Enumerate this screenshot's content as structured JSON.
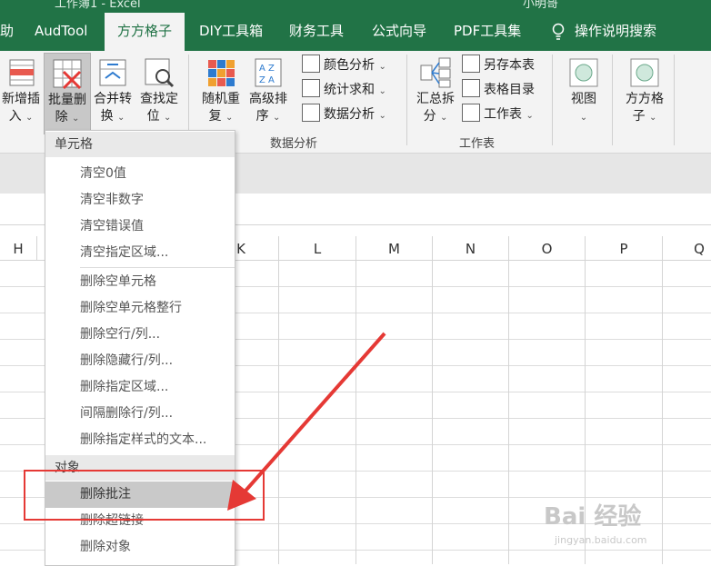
{
  "titlebar": {
    "title": "工作簿1 - Excel",
    "user": "小明哥"
  },
  "tabs": [
    {
      "label": "助"
    },
    {
      "label": "AudTool"
    },
    {
      "label": "方方格子"
    },
    {
      "label": "DIY工具箱"
    },
    {
      "label": "财务工具"
    },
    {
      "label": "公式向导"
    },
    {
      "label": "PDF工具集"
    },
    {
      "label": "操作说明搜索"
    }
  ],
  "ribbon": {
    "buttons": [
      {
        "line1": "新增插",
        "line2": "入"
      },
      {
        "line1": "批量删",
        "line2": "除"
      },
      {
        "line1": "合并转",
        "line2": "换"
      },
      {
        "line1": "查找定",
        "line2": "位"
      },
      {
        "line1": "随机重",
        "line2": "复"
      },
      {
        "line1": "高级排",
        "line2": "序"
      },
      {
        "line1": "汇总拆",
        "line2": "分"
      },
      {
        "line1": "视图",
        "line2": ""
      },
      {
        "line1": "方方格",
        "line2": "子"
      }
    ],
    "small": {
      "color_analysis": "颜色分析",
      "stat_sum": "统计求和",
      "data_analysis": "数据分析",
      "save_sheet": "另存本表",
      "sheet_index": "表格目录",
      "worksheet": "工作表"
    },
    "groups": {
      "data_analysis": "数据分析",
      "worksheet": "工作表"
    },
    "icon_letters": {
      "az_top": "A Z",
      "az_bottom": "Z A"
    }
  },
  "columns": [
    "H",
    "K",
    "L",
    "M",
    "N",
    "O",
    "P",
    "Q"
  ],
  "menu": {
    "section1": "单元格",
    "items1": [
      "清空0值",
      "清空非数字",
      "清空错误值",
      "清空指定区域..."
    ],
    "items2": [
      "删除空单元格",
      "删除空单元格整行",
      "删除空行/列...",
      "删除隐藏行/列...",
      "删除指定区域...",
      "间隔删除行/列...",
      "删除指定样式的文本..."
    ],
    "section2": "对象",
    "items3": [
      "删除批注",
      "删除超链接",
      "删除对象"
    ],
    "highlighted_index": 0
  },
  "watermark": {
    "main": "Bai 经验",
    "url": "jingyan.baidu.com"
  },
  "colors": {
    "excel_green": "#217346",
    "annotation_red": "#e53935"
  }
}
